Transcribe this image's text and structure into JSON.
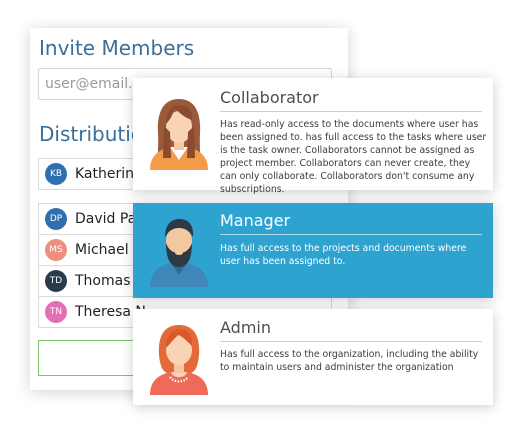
{
  "invite": {
    "title": "Invite Members",
    "email_placeholder": "user@email.com",
    "distribution_title": "Distribution",
    "members": [
      {
        "initials": "KB",
        "name": "Katherine",
        "color": "#2f6fb0"
      },
      {
        "initials": "DP",
        "name": "David Par",
        "color": "#2f6fb0"
      },
      {
        "initials": "MS",
        "name": "Michael S",
        "color": "#ee8f7e"
      },
      {
        "initials": "TD",
        "name": "Thomas D",
        "color": "#2a3b4e"
      },
      {
        "initials": "TN",
        "name": "Theresa N",
        "color": "#e36fb6"
      }
    ],
    "send_icon": "paper-plane-icon",
    "send_icon_color": "#6cc05a"
  },
  "roles": [
    {
      "title": "Collaborator",
      "description": "Has read-only access to the documents where user has been assigned to. has full access to the tasks where user is the task owner. Collaborators cannot be assigned as project member. Collaborators can never create, they can only collaborate. Collaborators don't consume any subscriptions.",
      "avatar_icon": "woman-avatar-icon",
      "selected": false
    },
    {
      "title": "Manager",
      "description": "Has full access to the projects and documents where user has been assigned to.",
      "avatar_icon": "bearded-man-avatar-icon",
      "selected": true
    },
    {
      "title": "Admin",
      "description": "Has full access to the organization, including the ability to maintain users and administer the organization",
      "avatar_icon": "redhead-woman-avatar-icon",
      "selected": false
    }
  ],
  "colors": {
    "accent_blue": "#2fa3d0",
    "title_blue": "#3a6f9a"
  }
}
